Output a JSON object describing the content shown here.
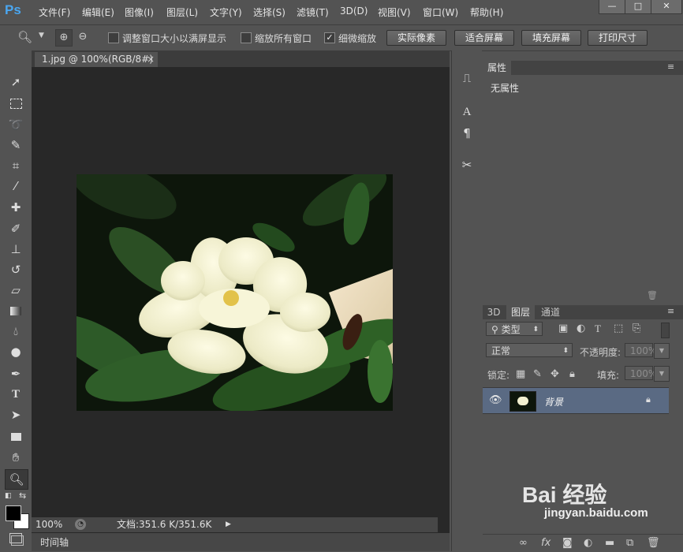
{
  "app": {
    "logo": "Ps"
  },
  "menu": [
    "文件(F)",
    "编辑(E)",
    "图像(I)",
    "图层(L)",
    "文字(Y)",
    "选择(S)",
    "滤镜(T)",
    "3D(D)",
    "视图(V)",
    "窗口(W)",
    "帮助(H)"
  ],
  "window_controls": {
    "minimize": "—",
    "maximize": "□",
    "close": "✕"
  },
  "options": {
    "resize_windows_label": "调整窗口大小以满屏显示",
    "zoom_all_label": "缩放所有窗口",
    "scrubby_label": "细微缩放",
    "scrubby_checked": true,
    "actual_pixels": "实际像素",
    "fit_screen": "适合屏幕",
    "fill_screen": "填充屏幕",
    "print_size": "打印尺寸"
  },
  "document": {
    "tab_title": "1.jpg @ 100%(RGB/8#)",
    "zoom": "100%",
    "doc_info": "文档:351.6 K/351.6K"
  },
  "timeline": {
    "label": "时间轴"
  },
  "properties": {
    "title": "属性",
    "empty_text": "无属性"
  },
  "layers_panel": {
    "tabs": [
      "3D",
      "图层",
      "通道"
    ],
    "active_tab": "图层",
    "filter_kind": "类型",
    "blend_mode": "正常",
    "opacity_label": "不透明度:",
    "opacity_value": "100%",
    "lock_label": "锁定:",
    "fill_label": "填充:",
    "fill_value": "100%",
    "layers": [
      {
        "name": "背景",
        "visible": true,
        "locked": true
      }
    ]
  },
  "colors": {
    "accent": "#4aa6f0",
    "panel": "#535353",
    "canvas": "#282828",
    "selected_layer": "#5a6a83"
  },
  "watermark": {
    "brand": "Bai 经验",
    "url": "jingyan.baidu.com"
  }
}
